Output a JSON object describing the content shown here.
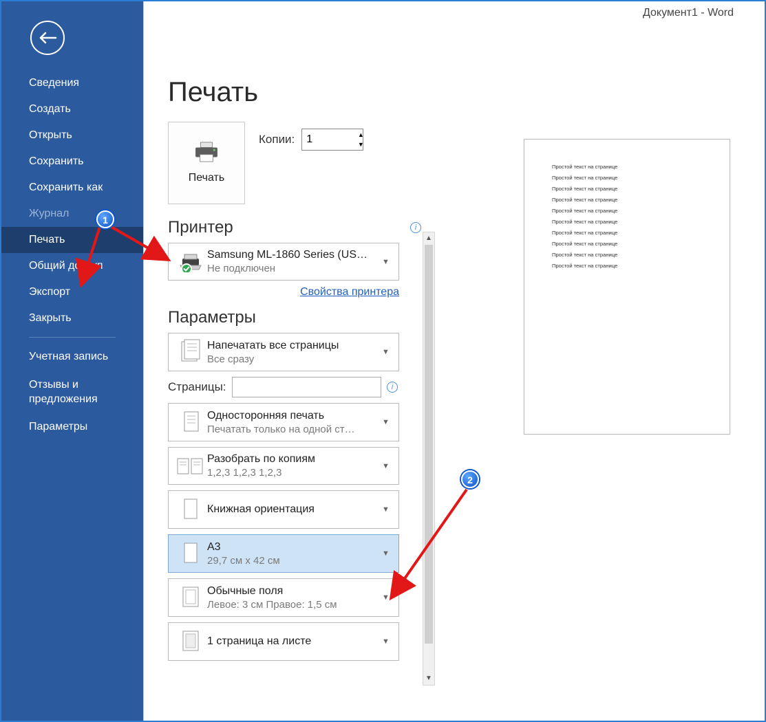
{
  "titleBar": "Документ1  -  Word",
  "sidebar": {
    "items": [
      {
        "label": "Сведения"
      },
      {
        "label": "Создать"
      },
      {
        "label": "Открыть"
      },
      {
        "label": "Сохранить"
      },
      {
        "label": "Сохранить как"
      },
      {
        "label": "Журнал",
        "disabled": true
      },
      {
        "label": "Печать",
        "active": true
      },
      {
        "label": "Общий доступ"
      },
      {
        "label": "Экспорт"
      },
      {
        "label": "Закрыть"
      }
    ],
    "bottomItems": [
      {
        "label": "Учетная запись"
      },
      {
        "label": "Отзывы и предложения"
      },
      {
        "label": "Параметры"
      }
    ]
  },
  "pageTitle": "Печать",
  "print": {
    "buttonLabel": "Печать",
    "copiesLabel": "Копии:",
    "copiesValue": "1"
  },
  "printer": {
    "sectionTitle": "Принтер",
    "name": "Samsung ML-1860 Series (US…",
    "status": "Не подключен",
    "propertiesLink": "Свойства принтера"
  },
  "settings": {
    "sectionTitle": "Параметры",
    "pagesLabel": "Страницы:",
    "pagesValue": "",
    "options": [
      {
        "line1": "Напечатать все страницы",
        "line2": "Все сразу",
        "icon": "pages"
      },
      {
        "line1": "Односторонняя печать",
        "line2": "Печатать только на одной ст…",
        "icon": "onesided"
      },
      {
        "line1": "Разобрать по копиям",
        "line2": "1,2,3    1,2,3    1,2,3",
        "icon": "collate"
      },
      {
        "line1": "Книжная ориентация",
        "line2": "",
        "icon": "portrait"
      },
      {
        "line1": "A3",
        "line2": "29,7 см x 42 см",
        "icon": "paper",
        "highlight": true
      },
      {
        "line1": "Обычные поля",
        "line2": "Левое:  3 см    Правое:  1,5 см",
        "icon": "margins"
      },
      {
        "line1": "1 страница на листе",
        "line2": "",
        "icon": "onesheet"
      }
    ]
  },
  "previewLine": "Простой текст на странице",
  "previewLineCount": 10,
  "callouts": {
    "1": "1",
    "2": "2"
  }
}
